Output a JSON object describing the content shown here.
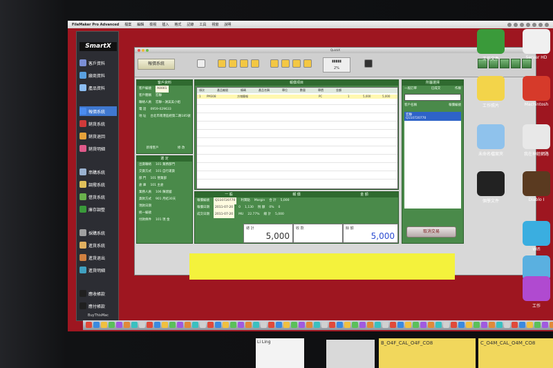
{
  "menubar": {
    "app": "FileMaker Pro Advanced",
    "items": [
      "檔案",
      "編輯",
      "檢視",
      "插入",
      "格式",
      "記錄",
      "工具",
      "視窗",
      "說明"
    ]
  },
  "sidebar": {
    "logo": "SmartX",
    "items": [
      {
        "label": "客戶資料",
        "color": "#7b8fd6"
      },
      {
        "label": "廠商資料",
        "color": "#5aa0e0"
      },
      {
        "label": "產品資料",
        "color": "#8cbdf2"
      },
      {
        "label": "報價系統",
        "color": "#4a8cf0",
        "active": true
      },
      {
        "label": "銷貨系統",
        "color": "#d03a3a"
      },
      {
        "label": "銷貨退回",
        "color": "#e6a23a"
      },
      {
        "label": "銷貨明細",
        "color": "#e05a8a"
      },
      {
        "label": "串購系統",
        "color": "#9ab2d0"
      },
      {
        "label": "調撥系統",
        "color": "#e0c05a"
      },
      {
        "label": "借貨系統",
        "color": "#6ab04c"
      },
      {
        "label": "庫存調整",
        "color": "#3a9a3a"
      },
      {
        "label": "採購系統",
        "color": "#a0a0a0"
      },
      {
        "label": "進貨系統",
        "color": "#e0b060"
      },
      {
        "label": "進貨退出",
        "color": "#d08040"
      },
      {
        "label": "進貨明細",
        "color": "#40a0c0"
      },
      {
        "label": "應收帳款",
        "color": "#202020"
      },
      {
        "label": "應付帳款",
        "color": "#202020"
      }
    ],
    "footer": "BuyThisMac"
  },
  "window": {
    "title": "QuickX",
    "mode_button": "報價系統",
    "percent": "2%",
    "cancel": "取消交易"
  },
  "left_panel": {
    "header": "客戶資料",
    "customer_code_label": "客戶編號",
    "customer_code": "A0001",
    "rows": [
      {
        "label": "客戶簡稱",
        "value": "宏聯"
      },
      {
        "label": "聯絡人員",
        "value": "宏聯－謝美美小姐"
      },
      {
        "label": "電 話",
        "value": "0959-029633"
      },
      {
        "label": "地 址",
        "value": "台北市南港區經貿二路185號"
      }
    ],
    "buttons": [
      "新增客戶",
      "修 改"
    ]
  },
  "terms_panel": {
    "header": "選 定",
    "rows": [
      {
        "label": "出貨聯絡",
        "value": "101 業務部門"
      },
      {
        "label": "交貨方式",
        "value": "101 自行運貨"
      },
      {
        "label": "部 門",
        "value": "101 營業部"
      },
      {
        "label": "倉 庫",
        "value": "101 主倉"
      },
      {
        "label": "業務人員",
        "value": "106 陳建國"
      },
      {
        "label": "貨款方式",
        "value": "901 月結30天"
      },
      {
        "label": "現款日期",
        "value": ""
      },
      {
        "label": "統一編號",
        "value": ""
      },
      {
        "label": "付款條件",
        "value": "101 現 金"
      }
    ]
  },
  "items": {
    "header": "報價項目",
    "columns": [
      "項次",
      "產品編號",
      "條碼",
      "產品名稱",
      "單位",
      "數量",
      "單價",
      "金額"
    ],
    "row": {
      "index": "1",
      "code": "PM308",
      "name": "方塊簡報",
      "unit": "PC",
      "qty": "1",
      "price": "5,000",
      "amount": "5,000"
    }
  },
  "summary": {
    "tabs": [
      "一 般",
      "報 價",
      "金 額"
    ],
    "rows": [
      {
        "label": "報價編號",
        "value": "Q110720770",
        "cost_label": "利潤點",
        "margin_label": "Margin",
        "mu_label": "MU",
        "a": "0",
        "b": "1,130",
        "c": "0"
      },
      {
        "label": "報價日期",
        "value": "2011-07-20",
        "a": "0",
        "b": "1,130",
        "c": "22.77%"
      },
      {
        "label": "成交日期",
        "value": "2011-07-20",
        "a": "0%",
        "b": "22.77%",
        "c": "20%"
      }
    ],
    "totals_right": [
      {
        "label": "合 計",
        "value": "5,000"
      },
      {
        "label": "稅 額",
        "value": "0",
        "pct": "0%"
      },
      {
        "label": "總 計",
        "value": "5,000"
      }
    ],
    "total_label": "總 計",
    "total_value": "5,000",
    "received_label": "收 款",
    "balance_label": "餘 額",
    "balance_value": "5,000"
  },
  "right_panel": {
    "header": "所屬選擇",
    "tabs": [
      "一般訂單",
      "已成交",
      "作廢"
    ],
    "col_headers": [
      "客戶名稱",
      "報價編號"
    ],
    "selected": {
      "name": "宏聯",
      "code": "Q110720770"
    }
  },
  "desktop_icons": [
    {
      "label": "工作文件",
      "color": "#3a9a3a"
    },
    {
      "label": "Server HD",
      "color": "#f0f0f0"
    },
    {
      "label": "工作照片",
      "color": "#f3d44a"
    },
    {
      "label": "Machintosh",
      "color": "#d63a2a"
    },
    {
      "label": "未命名檔案夾",
      "color": "#8fc2ec"
    },
    {
      "label": "我在神經網路",
      "color": "#e8e8e8"
    },
    {
      "label": "個學文件",
      "color": "#222222"
    },
    {
      "label": "Diablo I",
      "color": "#5a3a20"
    },
    {
      "label": "Wifi",
      "color": "#3aaee0"
    },
    {
      "label": "iReceive",
      "color": "#5ab0e0"
    },
    {
      "label": "工作",
      "color": "#b04ad0"
    }
  ],
  "below_screen": {
    "paper_left": "Li Ling",
    "sticky_right": "B_O4F_CAL_O4F_CO8",
    "sticky_right2": "C_O4M_CAL_O4M_CO8"
  }
}
